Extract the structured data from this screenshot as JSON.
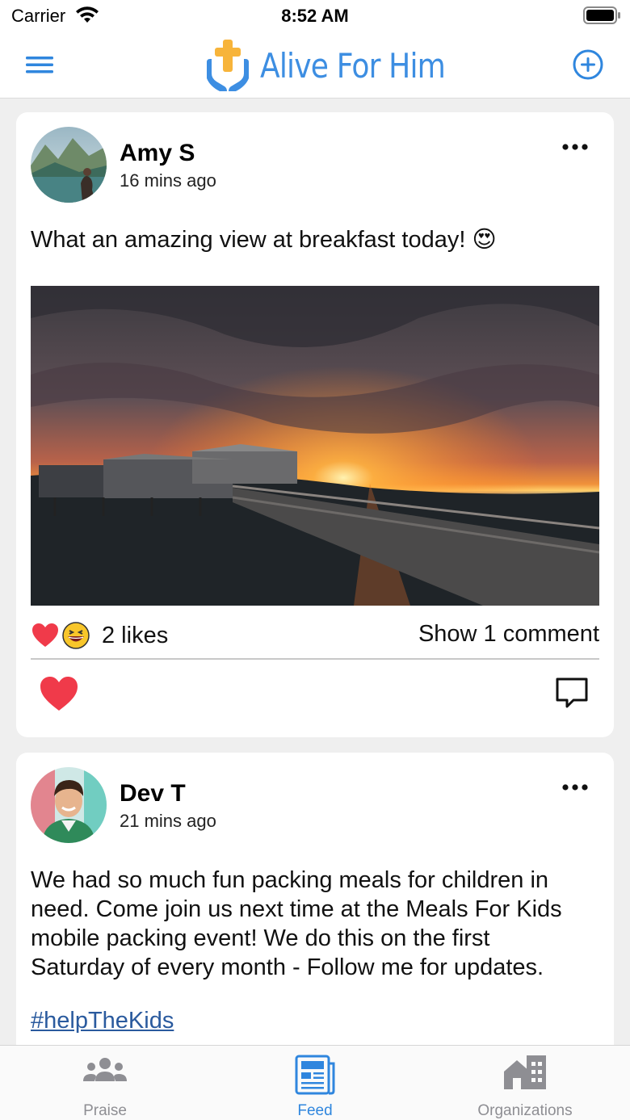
{
  "status_bar": {
    "carrier": "Carrier",
    "time": "8:52 AM"
  },
  "header": {
    "app_name": "Alive For Him",
    "brand_color": "#3d8ee2"
  },
  "posts": [
    {
      "author": "Amy S",
      "time": "16 mins ago",
      "text": "What an amazing view at breakfast today! 😍",
      "likes": "2 likes",
      "comments_link": "Show 1 comment",
      "reactions": [
        "heart-icon",
        "grin-emoji-icon"
      ]
    },
    {
      "author": "Dev T",
      "time": "21 mins ago",
      "text_lines": [
        "We had so much fun packing meals for children in",
        "need. Come join us next time at the Meals For Kids",
        "mobile packing event! We do this on the first",
        "Saturday of every month - Follow me for updates."
      ],
      "hashtag": "#helpTheKids"
    }
  ],
  "tabs": [
    {
      "label": "Praise",
      "icon": "group-icon",
      "active": false
    },
    {
      "label": "Feed",
      "icon": "newspaper-icon",
      "active": true
    },
    {
      "label": "Organizations",
      "icon": "buildings-icon",
      "active": false
    }
  ],
  "colors": {
    "accent": "#3d8ee2",
    "heart": "#f03a4a",
    "tab_inactive": "#8e8e93",
    "link": "#2a5a9e"
  }
}
